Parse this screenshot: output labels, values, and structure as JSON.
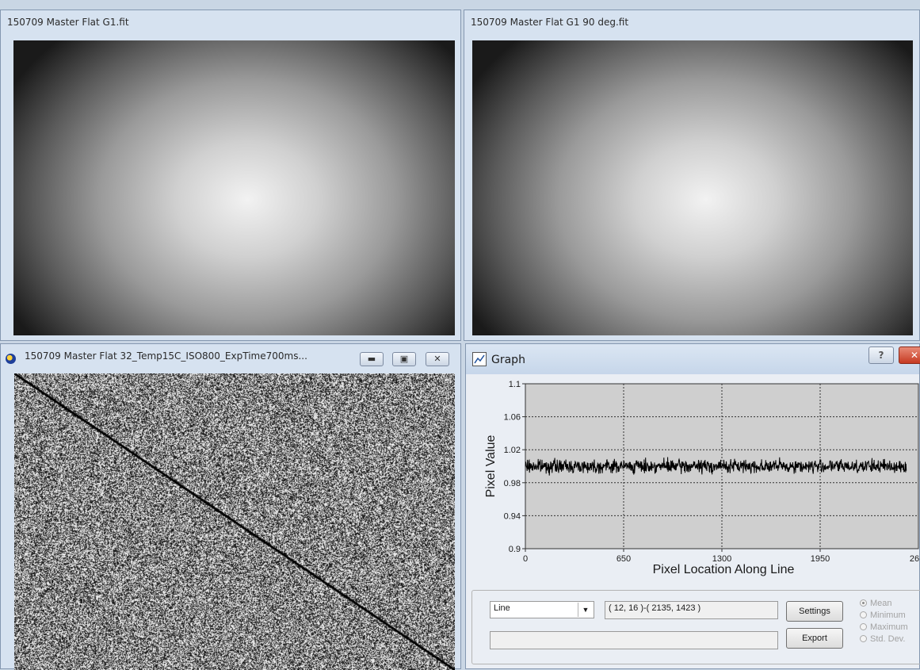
{
  "windows": {
    "flat1": {
      "title": "150709 Master Flat G1.fit"
    },
    "flat2": {
      "title": "150709 Master Flat G1 90 deg.fit"
    },
    "flat32": {
      "title": "150709 Master Flat 32_Temp15C_ISO800_ExpTime700ms..."
    }
  },
  "graph": {
    "title": "Graph",
    "help_label": "?",
    "mode_select": {
      "value": "Line",
      "options": [
        "Line"
      ]
    },
    "coords": "( 12, 16 )-( 2135, 1423 )",
    "second_field": "",
    "settings_label": "Settings",
    "export_label": "Export",
    "stat_options": [
      {
        "label": "Mean",
        "selected": true
      },
      {
        "label": "Minimum",
        "selected": false
      },
      {
        "label": "Maximum",
        "selected": false
      },
      {
        "label": "Std. Dev.",
        "selected": false
      }
    ]
  },
  "chart_data": {
    "type": "line",
    "xlabel": "Pixel Location Along Line",
    "ylabel": "Pixel Value",
    "xlim": [
      0,
      2600
    ],
    "ylim": [
      0.9,
      1.1
    ],
    "x_ticks": [
      0,
      650,
      1300,
      1950
    ],
    "x_tick_labels": [
      "0",
      "650",
      "1300",
      "1950",
      "26"
    ],
    "y_ticks": [
      0.9,
      0.94,
      0.98,
      1.02,
      1.06,
      1.1
    ],
    "y_tick_labels": [
      "0.9",
      "0.94",
      "0.98",
      "1.02",
      "1.06",
      "1.1"
    ],
    "grid": true,
    "series": [
      {
        "x_range": [
          0,
          2520
        ],
        "mean": 1.0,
        "noise_amplitude": 0.012,
        "color": "#000000"
      }
    ]
  },
  "colors": {
    "plot_background": "#cfcfcf",
    "close_button": "#d9513c"
  }
}
